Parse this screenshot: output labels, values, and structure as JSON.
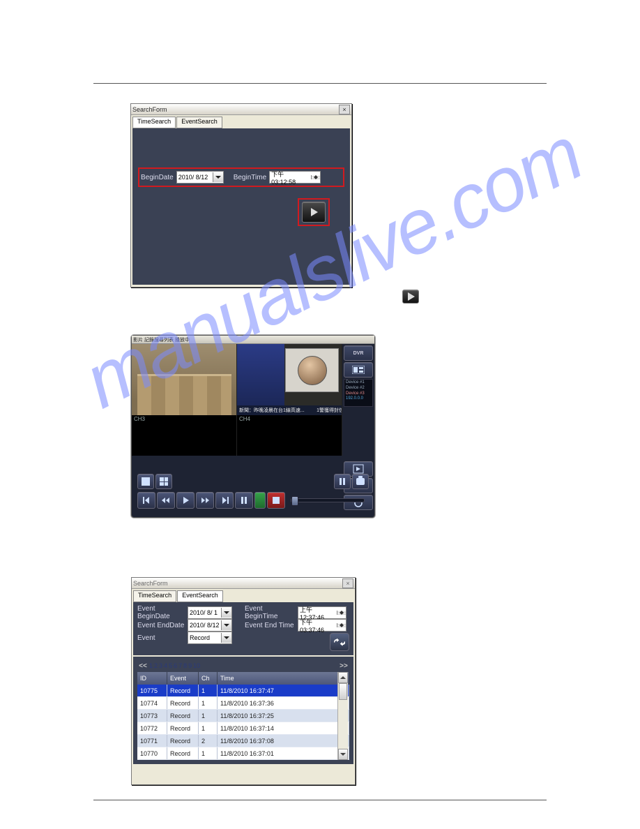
{
  "figure1": {
    "title": "SearchForm",
    "tabs": {
      "timeSearch": "TimeSearch",
      "eventSearch": "EventSearch"
    },
    "beginDateLabel": "BeginDate",
    "beginDateValue": "2010/ 8/12",
    "beginTimeLabel": "BeginTime",
    "beginTimeValue": "下午 03:12:58"
  },
  "figure2": {
    "meta": "影片 記錄搜尋列表 播放中",
    "ch3": "CH3",
    "ch4": "CH4",
    "captionLeft": "新聞：昨晚凌晨在台1線高速...",
    "captionRight": "1警獲得封信",
    "device": {
      "l1": "Device #1",
      "l2": "Device #2",
      "l3": "Device #3",
      "l4": "192.0.0.0"
    },
    "rbtn1": "DVR",
    "rbtn2": "Layout"
  },
  "figure3": {
    "title": "SearchForm",
    "tabs": {
      "timeSearch": "TimeSearch",
      "eventSearch": "EventSearch"
    },
    "eventBeginDateLabel": "Event BeginDate",
    "eventBeginDateValue": "2010/ 8/ 1",
    "eventBeginTimeLabel": "Event BeginTime",
    "eventBeginTimeValue": "上午 12:37:46",
    "eventEndDateLabel": "Event EndDate",
    "eventEndDateValue": "2010/ 8/12",
    "eventEndTimeLabel": "Event End Time",
    "eventEndTimeValue": "下午 03:37:46",
    "eventLabel": "Event",
    "eventValue": "Record",
    "pager": {
      "prev": "<<",
      "next": ">>",
      "p1": "1",
      "p2": "2",
      "p3": "3",
      "p4": "4",
      "p5": "5",
      "p6": "6",
      "p7": "7",
      "p8": "8",
      "p9": "9",
      "p10": "10"
    },
    "columns": {
      "id": "ID",
      "event": "Event",
      "ch": "Ch",
      "time": "Time"
    },
    "rows": [
      {
        "id": "10775",
        "event": "Record",
        "ch": "1",
        "time": "11/8/2010 16:37:47"
      },
      {
        "id": "10774",
        "event": "Record",
        "ch": "1",
        "time": "11/8/2010 16:37:36"
      },
      {
        "id": "10773",
        "event": "Record",
        "ch": "1",
        "time": "11/8/2010 16:37:25"
      },
      {
        "id": "10772",
        "event": "Record",
        "ch": "1",
        "time": "11/8/2010 16:37:14"
      },
      {
        "id": "10771",
        "event": "Record",
        "ch": "2",
        "time": "11/8/2010 16:37:08"
      },
      {
        "id": "10770",
        "event": "Record",
        "ch": "1",
        "time": "11/8/2010 16:37:01"
      }
    ]
  }
}
